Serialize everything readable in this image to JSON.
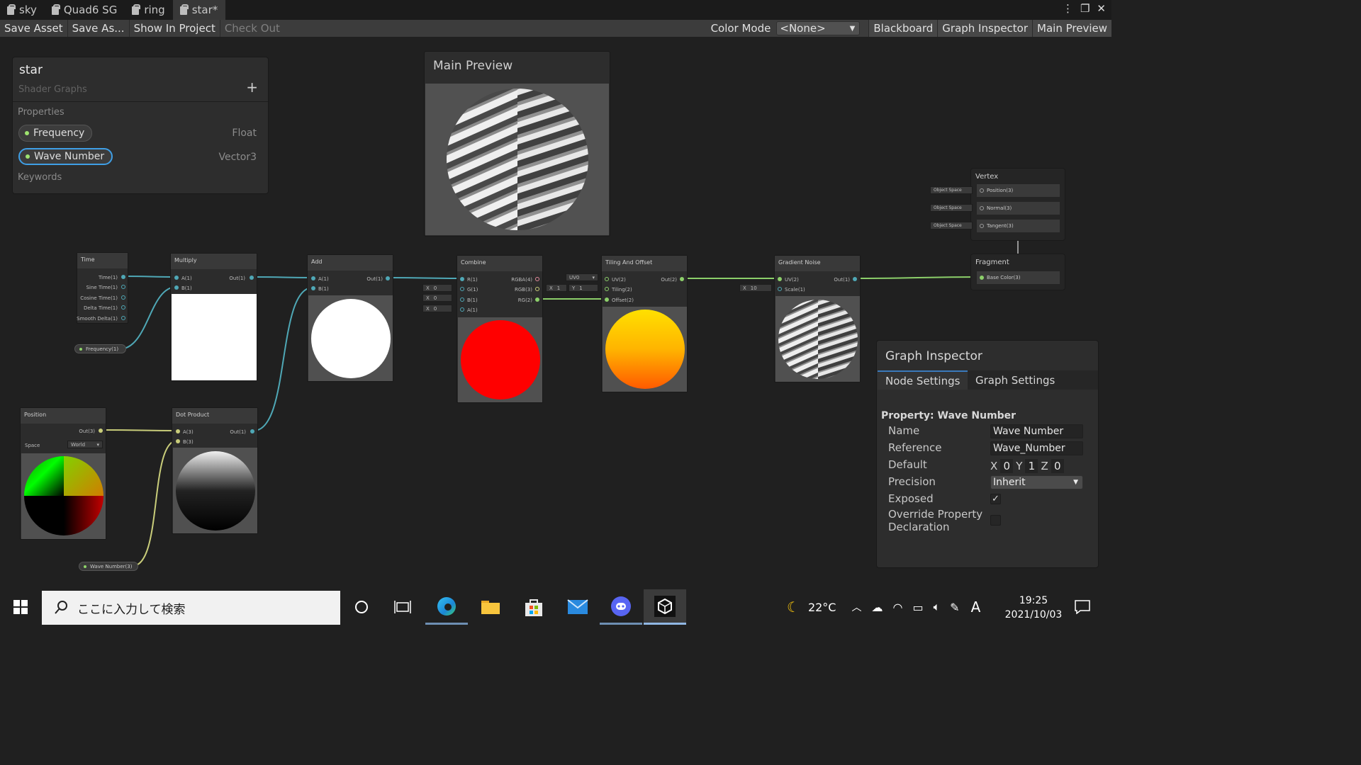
{
  "tabs": [
    {
      "label": "sky",
      "active": false
    },
    {
      "label": "Quad6 SG",
      "active": false
    },
    {
      "label": "ring",
      "active": false
    },
    {
      "label": "star*",
      "active": true
    }
  ],
  "toolbar": {
    "save_asset": "Save Asset",
    "save_as": "Save As...",
    "show_in_project": "Show In Project",
    "check_out": "Check Out",
    "color_mode_label": "Color Mode",
    "color_mode_value": "<None>",
    "blackboard": "Blackboard",
    "graph_inspector": "Graph Inspector",
    "main_preview": "Main Preview"
  },
  "blackboard": {
    "title": "star",
    "subtitle": "Shader Graphs",
    "properties_label": "Properties",
    "keywords_label": "Keywords",
    "properties": [
      {
        "name": "Frequency",
        "type": "Float"
      },
      {
        "name": "Wave Number",
        "type": "Vector3"
      }
    ]
  },
  "main_preview": {
    "title": "Main Preview"
  },
  "nodes": {
    "time": {
      "title": "Time",
      "outputs": [
        "Time(1)",
        "Sine Time(1)",
        "Cosine Time(1)",
        "Delta Time(1)",
        "Smooth Delta(1)"
      ]
    },
    "frequency_prop": {
      "label": "Frequency(1)"
    },
    "multiply": {
      "title": "Multiply",
      "inputs": [
        "A(1)",
        "B(1)"
      ],
      "output": "Out(1)"
    },
    "add": {
      "title": "Add",
      "inputs": [
        "A(1)",
        "B(1)"
      ],
      "output": "Out(1)"
    },
    "combine": {
      "title": "Combine",
      "inputs": [
        "R(1)",
        "G(1)",
        "B(1)",
        "A(1)"
      ],
      "outputs": [
        "RGBA(4)",
        "RGB(3)",
        "RG(2)"
      ],
      "fields": [
        {
          "axis": "X",
          "value": "0"
        },
        {
          "axis": "X",
          "value": "0"
        },
        {
          "axis": "X",
          "value": "0"
        }
      ]
    },
    "tiling": {
      "title": "Tiling And Offset",
      "inputs": [
        "UV(2)",
        "Tiling(2)",
        "Offset(2)"
      ],
      "output": "Out(2)",
      "uv_value": "UV0",
      "tiling_fields": [
        {
          "axis": "X",
          "value": "1"
        },
        {
          "axis": "Y",
          "value": "1"
        }
      ]
    },
    "noise": {
      "title": "Gradient Noise",
      "inputs": [
        "UV(2)",
        "Scale(1)"
      ],
      "output": "Out(1)",
      "scale_field": {
        "axis": "X",
        "value": "10"
      }
    },
    "position": {
      "title": "Position",
      "output": "Out(3)",
      "space_label": "Space",
      "space_value": "World"
    },
    "dot": {
      "title": "Dot Product",
      "inputs": [
        "A(3)",
        "B(3)"
      ],
      "output": "Out(1)"
    },
    "wave_prop": {
      "label": "Wave Number(3)"
    },
    "vertex": {
      "title": "Vertex",
      "rows": [
        "Position(3)",
        "Normal(3)",
        "Tangent(3)"
      ],
      "space_fields": [
        "Object Space",
        "Object Space",
        "Object Space"
      ]
    },
    "fragment": {
      "title": "Fragment",
      "rows": [
        "Base Color(3)"
      ]
    }
  },
  "inspector": {
    "title": "Graph Inspector",
    "tabs": [
      "Node Settings",
      "Graph Settings"
    ],
    "heading": "Property: Wave Number",
    "name_label": "Name",
    "name_value": "Wave Number",
    "reference_label": "Reference",
    "reference_value": "Wave_Number",
    "default_label": "Default",
    "default": [
      {
        "axis": "X",
        "value": "0"
      },
      {
        "axis": "Y",
        "value": "1"
      },
      {
        "axis": "Z",
        "value": "0"
      }
    ],
    "precision_label": "Precision",
    "precision_value": "Inherit",
    "exposed_label": "Exposed",
    "exposed": true,
    "override_label_1": "Override Property",
    "override_label_2": "Declaration",
    "override": false
  },
  "taskbar": {
    "search_placeholder": "ここに入力して検索",
    "temperature": "22°C",
    "time": "19:25",
    "date": "2021/10/03",
    "ime": "A"
  },
  "colors": {
    "wire_float": "#4fa8b6",
    "wire_vec3": "#c9cd7a",
    "wire_vec2": "#8ccf6a",
    "selection": "#3f9fe6"
  }
}
